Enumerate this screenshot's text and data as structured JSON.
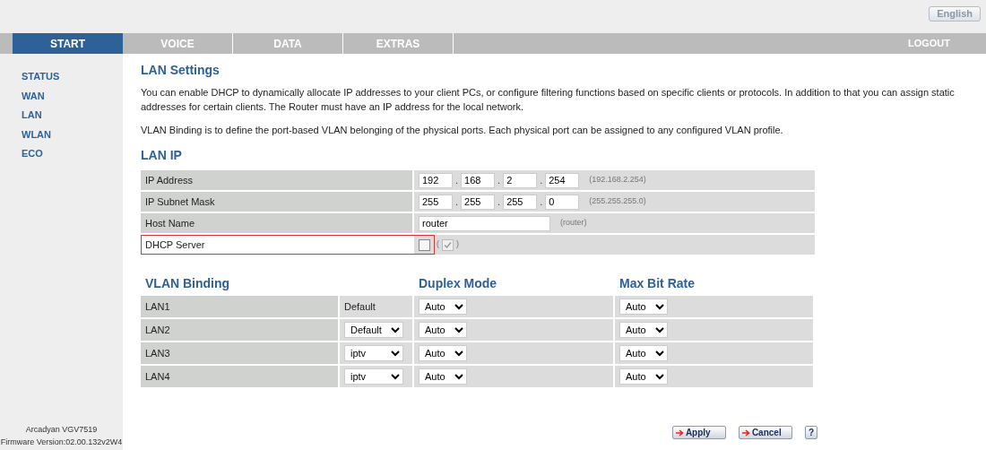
{
  "language_button": "English",
  "nav": [
    {
      "label": "START",
      "selected": true
    },
    {
      "label": "VOICE",
      "selected": false
    },
    {
      "label": "DATA",
      "selected": false
    },
    {
      "label": "EXTRAS",
      "selected": false
    }
  ],
  "logout": "LOGOUT",
  "sidebar": {
    "items": [
      {
        "label": "STATUS"
      },
      {
        "label": "WAN"
      },
      {
        "label": "LAN"
      },
      {
        "label": "WLAN"
      },
      {
        "label": "ECO"
      }
    ],
    "device": "Arcadyan VGV7519",
    "firmware": "Firmware Version:02.00.132v2W4"
  },
  "title": "LAN Settings",
  "paragraphs": [
    "You can enable DHCP to dynamically allocate IP addresses to your client PCs, or configure filtering functions based on specific clients or protocols. In addition to that you can assign static addresses for certain clients. The Router must have an IP address for the local network.",
    "VLAN Binding is to define the port-based VLAN belonging of the physical ports. Each physical port can be assigned to any configured VLAN profile."
  ],
  "lan_ip": {
    "heading": "LAN IP",
    "rows": [
      {
        "kind": "ip",
        "label": "IP Address",
        "octets": [
          "192",
          "168",
          "2",
          "254"
        ],
        "separator": ".",
        "hint": "(192.168.2.254)"
      },
      {
        "kind": "ip",
        "label": "IP Subnet Mask",
        "octets": [
          "255",
          "255",
          "255",
          "0"
        ],
        "separator": ".",
        "hint": "(255.255.255.0)"
      },
      {
        "kind": "text",
        "label": "Host Name",
        "value": "router",
        "hint": "(router)"
      },
      {
        "kind": "checkbox",
        "label": "DHCP Server",
        "checked": false,
        "highlighted": true,
        "hint_open": "(",
        "default_checked": true,
        "hint_close": ")"
      }
    ]
  },
  "vlan": {
    "headings": [
      "VLAN Binding",
      "Duplex Mode",
      "Max Bit Rate"
    ],
    "rows": [
      {
        "port": "LAN1",
        "vlan": {
          "kind": "text",
          "value": "Default"
        },
        "duplex": "Auto",
        "bit_rate": "Auto"
      },
      {
        "port": "LAN2",
        "vlan": {
          "kind": "select",
          "value": "Default"
        },
        "duplex": "Auto",
        "bit_rate": "Auto"
      },
      {
        "port": "LAN3",
        "vlan": {
          "kind": "select",
          "value": "iptv"
        },
        "duplex": "Auto",
        "bit_rate": "Auto"
      },
      {
        "port": "LAN4",
        "vlan": {
          "kind": "select",
          "value": "iptv"
        },
        "duplex": "Auto",
        "bit_rate": "Auto"
      }
    ]
  },
  "buttons": [
    {
      "kind": "arrow",
      "label": "Apply"
    },
    {
      "kind": "arrow",
      "label": "Cancel"
    },
    {
      "kind": "plain",
      "label": "?"
    }
  ]
}
